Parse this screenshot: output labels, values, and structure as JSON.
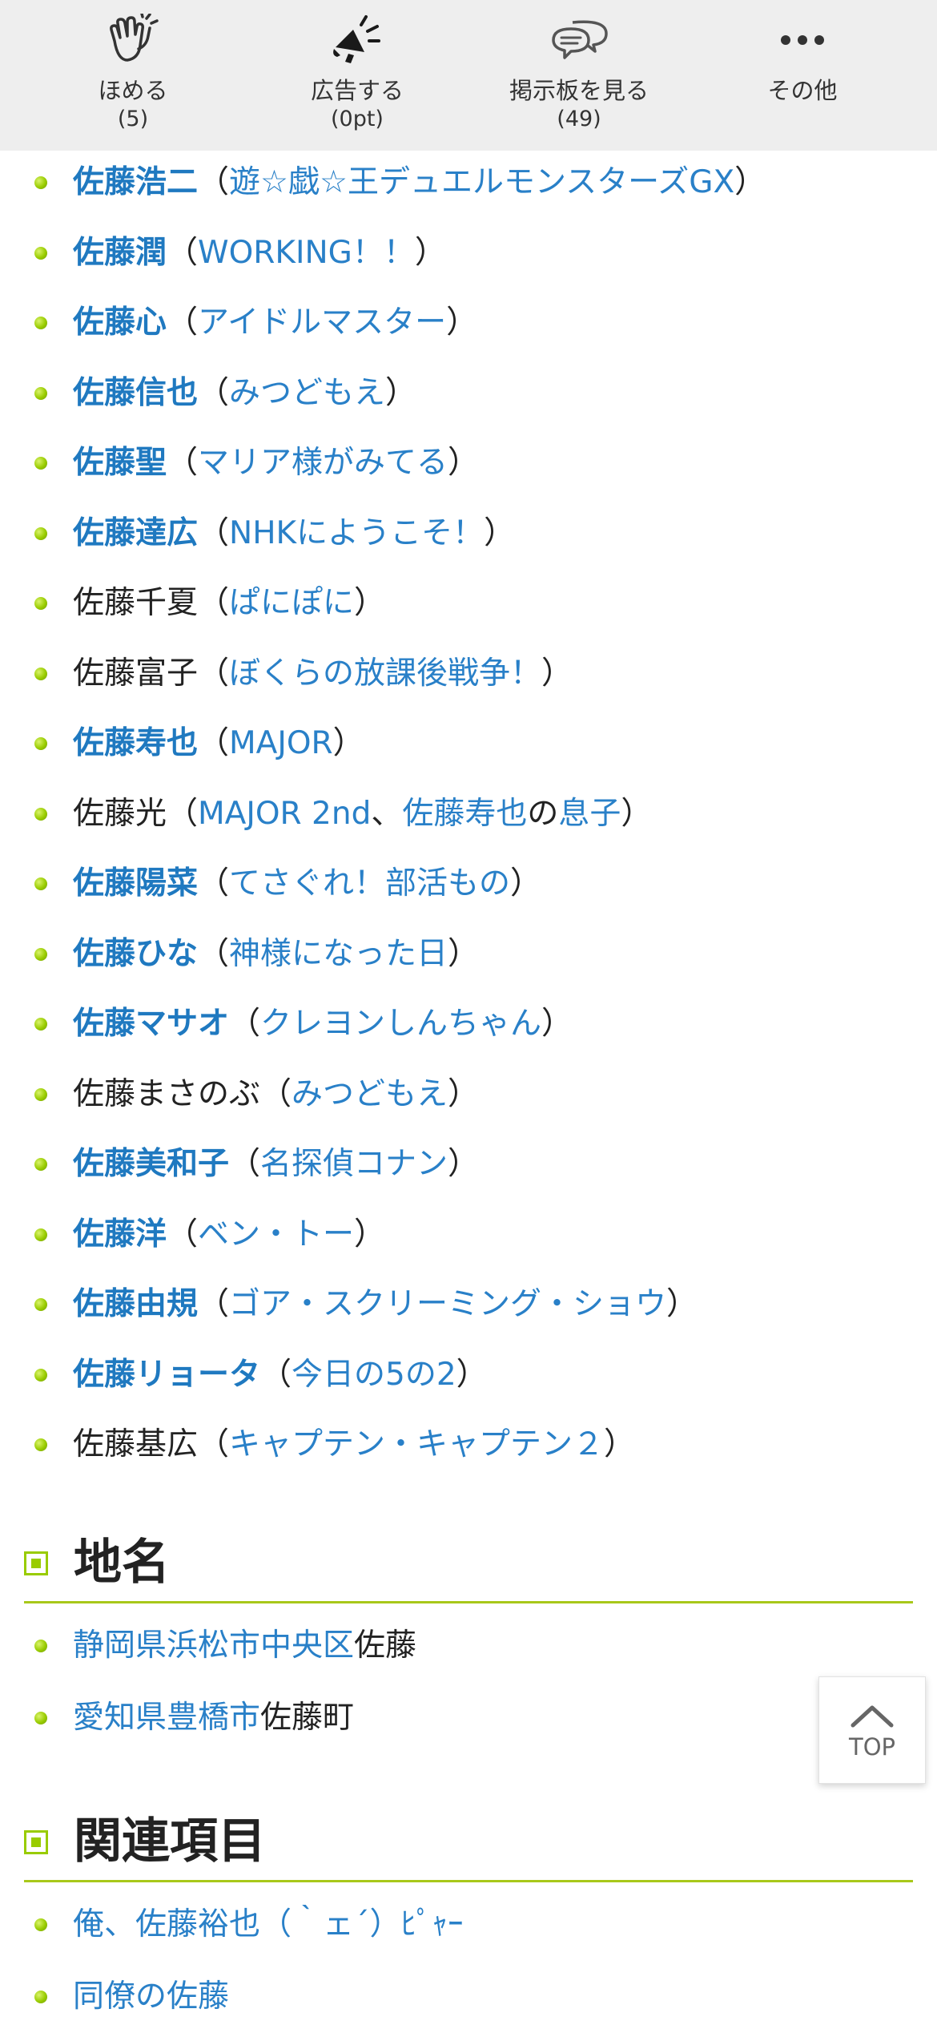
{
  "toolbar": {
    "items": [
      {
        "label": "ほめる",
        "count": "(5)",
        "icon": "clap-hands-icon"
      },
      {
        "label": "広告する",
        "count": "(0pt)",
        "icon": "megaphone-icon"
      },
      {
        "label": "掲示板を見る",
        "count": "(49)",
        "icon": "speech-bubbles-icon"
      },
      {
        "label": "その他",
        "count": "",
        "icon": "more-dots-icon"
      }
    ]
  },
  "characters": [
    {
      "name": "佐藤浩二",
      "link": true,
      "open": "（",
      "work": "遊☆戯☆王デュエルモンスターズGX",
      "close": "）"
    },
    {
      "name": "佐藤潤",
      "link": true,
      "open": "（",
      "work": "WORKING！！",
      "close": "）"
    },
    {
      "name": "佐藤心",
      "link": true,
      "open": "（",
      "work": "アイドルマスター",
      "close": "）"
    },
    {
      "name": "佐藤信也",
      "link": true,
      "open": "（",
      "work": "みつどもえ",
      "close": "）"
    },
    {
      "name": "佐藤聖",
      "link": true,
      "open": "（",
      "work": "マリア様がみてる",
      "close": "）"
    },
    {
      "name": "佐藤達広",
      "link": true,
      "open": "（",
      "work": "NHKにようこそ！",
      "close": "）"
    },
    {
      "name": "佐藤千夏",
      "link": false,
      "open": "（",
      "work": "ぱにぽに",
      "close": "）"
    },
    {
      "name": "佐藤富子",
      "link": false,
      "open": "（",
      "work": "ぼくらの放課後戦争！",
      "close": "）"
    },
    {
      "name": "佐藤寿也",
      "link": true,
      "open": "（",
      "work": "MAJOR",
      "close": "）"
    },
    {
      "name": "佐藤光",
      "link": false,
      "open": "（",
      "work": "MAJOR 2nd",
      "sep": "、",
      "work2": "佐藤寿也",
      "mid": "の",
      "work3": "息子",
      "close": "）"
    },
    {
      "name": "佐藤陽菜",
      "link": true,
      "open": "（",
      "work": "てさぐれ！部活もの",
      "close": "）"
    },
    {
      "name": "佐藤ひな",
      "link": true,
      "open": "（",
      "work": "神様になった日",
      "close": "）"
    },
    {
      "name": "佐藤マサオ",
      "link": true,
      "open": "（",
      "work": "クレヨンしんちゃん",
      "close": "）"
    },
    {
      "name": "佐藤まさのぶ",
      "link": false,
      "open": "（",
      "work": "みつどもえ",
      "close": "）"
    },
    {
      "name": "佐藤美和子",
      "link": true,
      "open": "（",
      "work": "名探偵コナン",
      "close": "）"
    },
    {
      "name": "佐藤洋",
      "link": true,
      "open": "（",
      "work": "ベン・トー",
      "close": "）"
    },
    {
      "name": "佐藤由規",
      "link": true,
      "open": "（",
      "work": "ゴア・スクリーミング・ショウ",
      "close": "）"
    },
    {
      "name": "佐藤リョータ",
      "link": true,
      "open": "（",
      "work": "今日の5の2",
      "close": "）"
    },
    {
      "name": "佐藤基広",
      "link": false,
      "open": "（",
      "work": "キャプテン・キャプテン２",
      "close": "）"
    }
  ],
  "places": {
    "heading": "地名",
    "items": [
      {
        "link": "静岡県浜松市中央区",
        "rest": "佐藤"
      },
      {
        "link": "愛知県豊橋市",
        "rest": "佐藤町"
      }
    ]
  },
  "related": {
    "heading": "関連項目",
    "items": [
      {
        "link": "俺、佐藤裕也（｀ェ´）ﾋﾟｬｰ"
      },
      {
        "link": "同僚の佐藤"
      }
    ]
  },
  "top_button": {
    "label": "TOP"
  },
  "colors": {
    "link": "#1f79c0",
    "accent": "#99cc00",
    "toolbar_bg": "#eeeeee"
  }
}
